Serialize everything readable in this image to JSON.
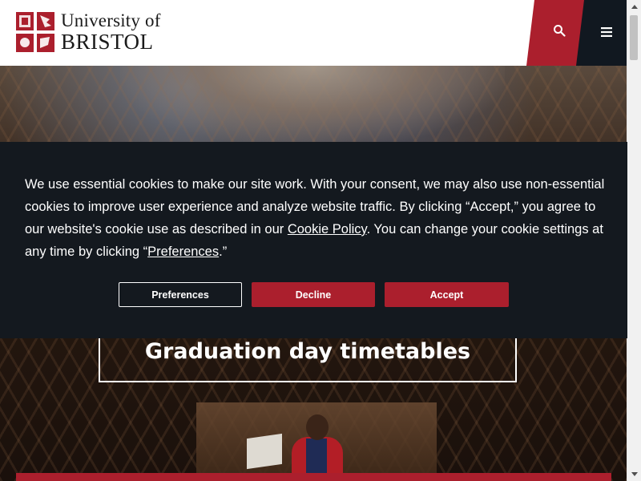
{
  "header": {
    "logo_line1": "University of",
    "logo_line2": "BRISTOL",
    "search_icon": "search-icon",
    "menu_icon": "hamburger-menu-icon"
  },
  "hero": {
    "timetable_title": "Graduation day timetables"
  },
  "cookie_banner": {
    "text_part1": "We use essential cookies to make our site work. With your consent, we may also use non-essential cookies to improve user experience and analyze website traffic. By clicking “Accept,” you agree to our website's cookie use as described in our ",
    "cookie_policy_link": "Cookie Policy",
    "text_part2": ". You can change your cookie settings at any time by clicking “",
    "preferences_link": "Preferences",
    "text_part3": ".”",
    "preferences_button": "Preferences",
    "decline_button": "Decline",
    "accept_button": "Accept"
  },
  "colors": {
    "brand_red": "#ab1f2d",
    "dark_navy": "#111820",
    "banner_bg": "#14191f"
  }
}
